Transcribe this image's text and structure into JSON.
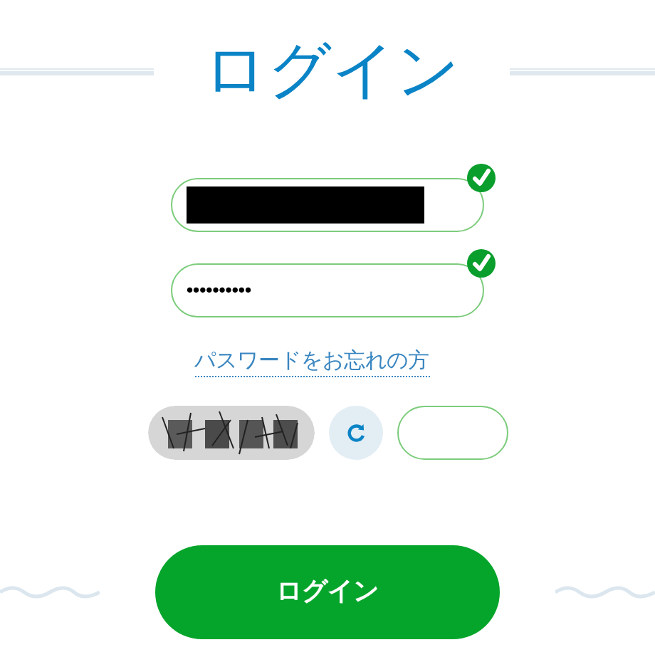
{
  "title": "ログイン",
  "fields": [
    {
      "redacted": true,
      "valid": true
    },
    {
      "value": "••••••••••",
      "valid": true
    }
  ],
  "forgot_link": "パスワードをお忘れの方",
  "login_button": "ログイン"
}
